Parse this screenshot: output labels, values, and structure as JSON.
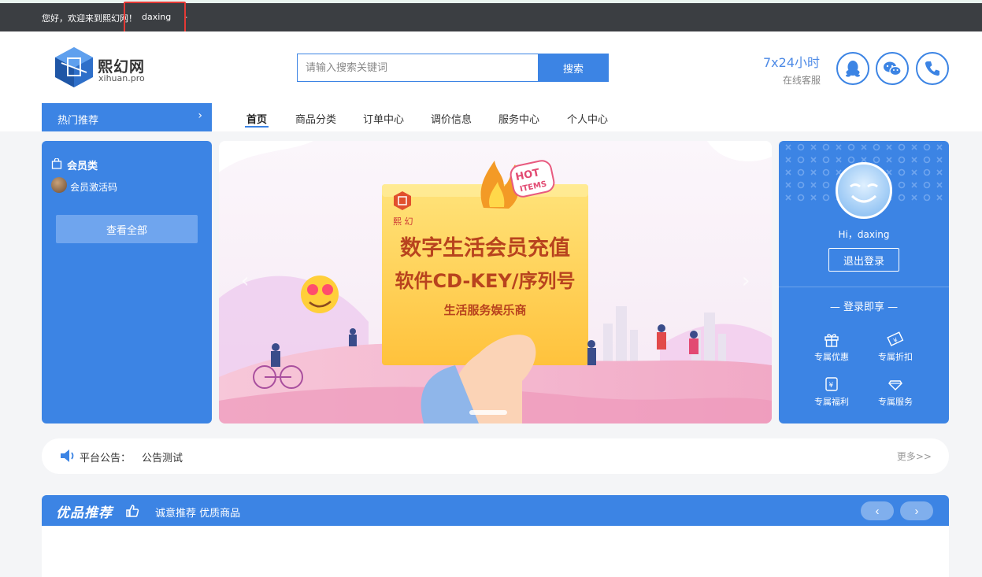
{
  "topbar": {
    "welcome": "您好，欢迎来到熙幻网！",
    "username": "daxing",
    "dash": "-"
  },
  "logo": {
    "name": "熙幻网",
    "sub": "xihuan.pro"
  },
  "search": {
    "placeholder": "请输入搜索关键词",
    "button": "搜索"
  },
  "service": {
    "time": "7x24小时",
    "label": "在线客服"
  },
  "hot": {
    "label": "热门推荐",
    "chevron": "›"
  },
  "nav": [
    {
      "label": "首页",
      "active": true
    },
    {
      "label": "商品分类"
    },
    {
      "label": "订单中心"
    },
    {
      "label": "调价信息"
    },
    {
      "label": "服务中心"
    },
    {
      "label": "个人中心"
    }
  ],
  "category": {
    "title": "会员类",
    "item": "会员激活码",
    "view_all": "查看全部"
  },
  "banner": {
    "hot1": "HOT",
    "hot2": "ITEMS",
    "brand": "熙 幻",
    "line1": "数字生活会员充值",
    "line2": "软件CD-KEY/序列号",
    "line3": "生活服务娱乐商",
    "prev": "‹",
    "next": "›"
  },
  "user": {
    "hi": "Hi，daxing",
    "logout": "退出登录",
    "perk_title": "— 登录即享 —",
    "perks": [
      "专属优惠",
      "专属折扣",
      "专属福利",
      "专属服务"
    ]
  },
  "notice": {
    "label": "平台公告：",
    "text": "公告测试",
    "more": "更多>>"
  },
  "recommend": {
    "title": "优品推荐",
    "subtitle": "诚意推荐 优质商品",
    "prev": "‹",
    "next": "›"
  },
  "colors": {
    "primary": "#3c84e4",
    "topbar": "#3b3e42",
    "annotation": "#e53935"
  }
}
